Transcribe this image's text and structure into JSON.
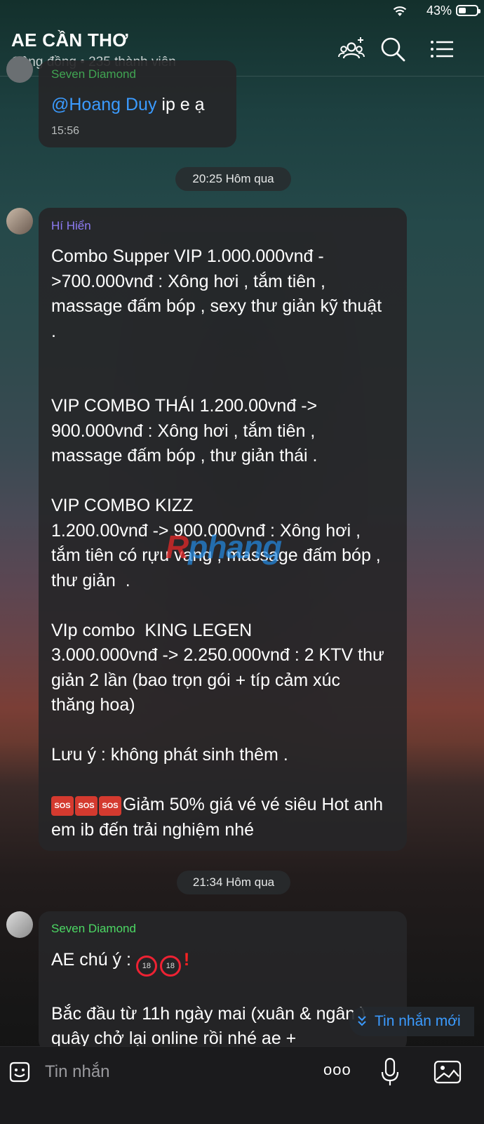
{
  "status_bar": {
    "battery_pct": "43%",
    "battery_level": 0.43
  },
  "header": {
    "title": "AE CẦN THƠ",
    "subtitle": "Cộng đồng • 235 thành viên"
  },
  "messages": [
    {
      "sender": "Seven Diamond",
      "sender_color": "#4cd964",
      "mention": "@Hoang Duy",
      "text": " ip e ạ",
      "time": "15:56"
    },
    {
      "separator": "20:25 Hôm qua"
    },
    {
      "sender": "Hí Hiển",
      "sender_color": "#8e7cf5",
      "text": "Combo Supper VIP 1.000.000vnđ ->700.000vnđ : Xông hơi , tắm tiên , massage đấm bóp , sexy thư giản kỹ thuật .\n\n\nVIP COMBO THÁI 1.200.00vnđ -> 900.000vnđ : Xông hơi , tắm tiên , massage đấm bóp , thư giản thái .\n\nVIP COMBO KIZZ\n1.200.00vnđ -> 900.000vnđ : Xông hơi , tắm tiên có rựu vang , massage đấm bóp , thư giản  .\n\nVIp combo  KING LEGEN\n3.000.000vnđ -> 2.250.000vnđ : 2 KTV thư giản 2 lần (bao trọn gói + típ cảm xúc thăng hoa)\n\nLưu ý : không phát sinh thêm .\n\n",
      "sos_label": "SOS",
      "tail": "Giảm 50% giá vé vé siêu Hot anh em ib đến trải nghiệm nhé"
    },
    {
      "separator": "21:34 Hôm qua"
    },
    {
      "sender": "Seven Diamond",
      "sender_color": "#4cd964",
      "text_head": "AE chú ý : ",
      "no18_label": "18",
      "text_body": "Bắc đầu từ 11h ngày mai (xuân & ngân ) quây chở lại online rồi nhé ae +"
    }
  ],
  "watermark": {
    "prefix": "R",
    "rest": "phang"
  },
  "new_messages_label": "Tin nhắn mới",
  "input": {
    "placeholder": "Tin nhắn",
    "more_label": "ooo"
  },
  "colors": {
    "accent": "#3b9bff",
    "bubble": "#262628",
    "sos": "#d43a2f"
  }
}
